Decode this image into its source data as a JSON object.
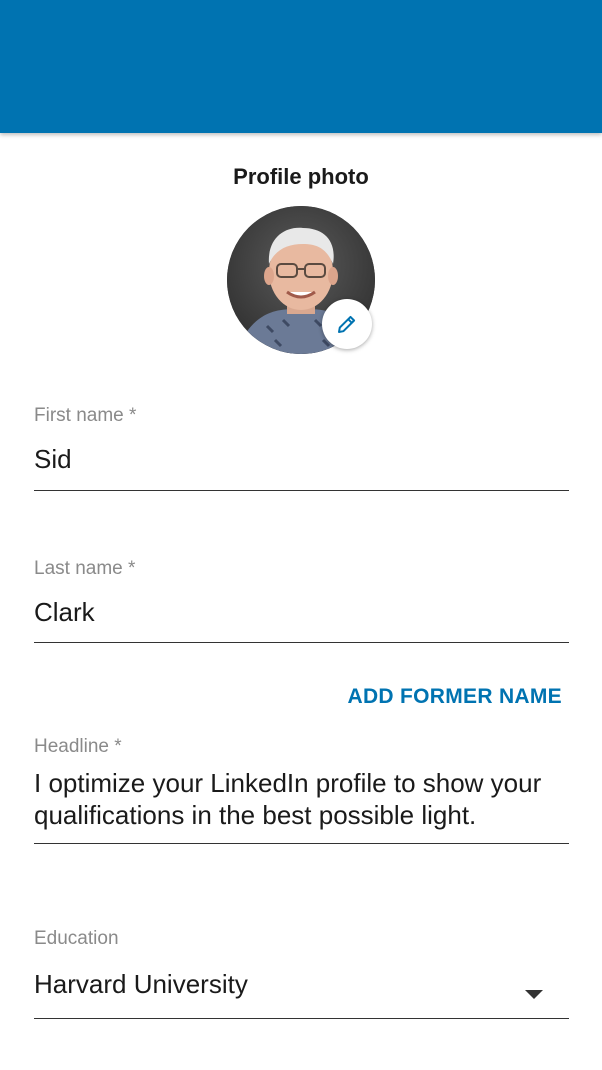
{
  "header": {
    "background_color": "#0073b1"
  },
  "profile_photo": {
    "title": "Profile photo",
    "edit_icon": "pencil-icon"
  },
  "fields": {
    "first_name": {
      "label": "First name *",
      "value": "Sid"
    },
    "last_name": {
      "label": "Last name *",
      "value": "Clark"
    },
    "add_former_name": "ADD FORMER NAME",
    "headline": {
      "label": "Headline *",
      "value_line1": "I optimize your LinkedIn profile to show your",
      "value_line2": "qualifications in the best possible light."
    },
    "education": {
      "label": "Education",
      "value": "Harvard University",
      "icon": "dropdown-arrow-icon"
    }
  },
  "colors": {
    "accent": "#0073b1",
    "label": "#8a8a8a",
    "text": "#1a1a1a"
  }
}
